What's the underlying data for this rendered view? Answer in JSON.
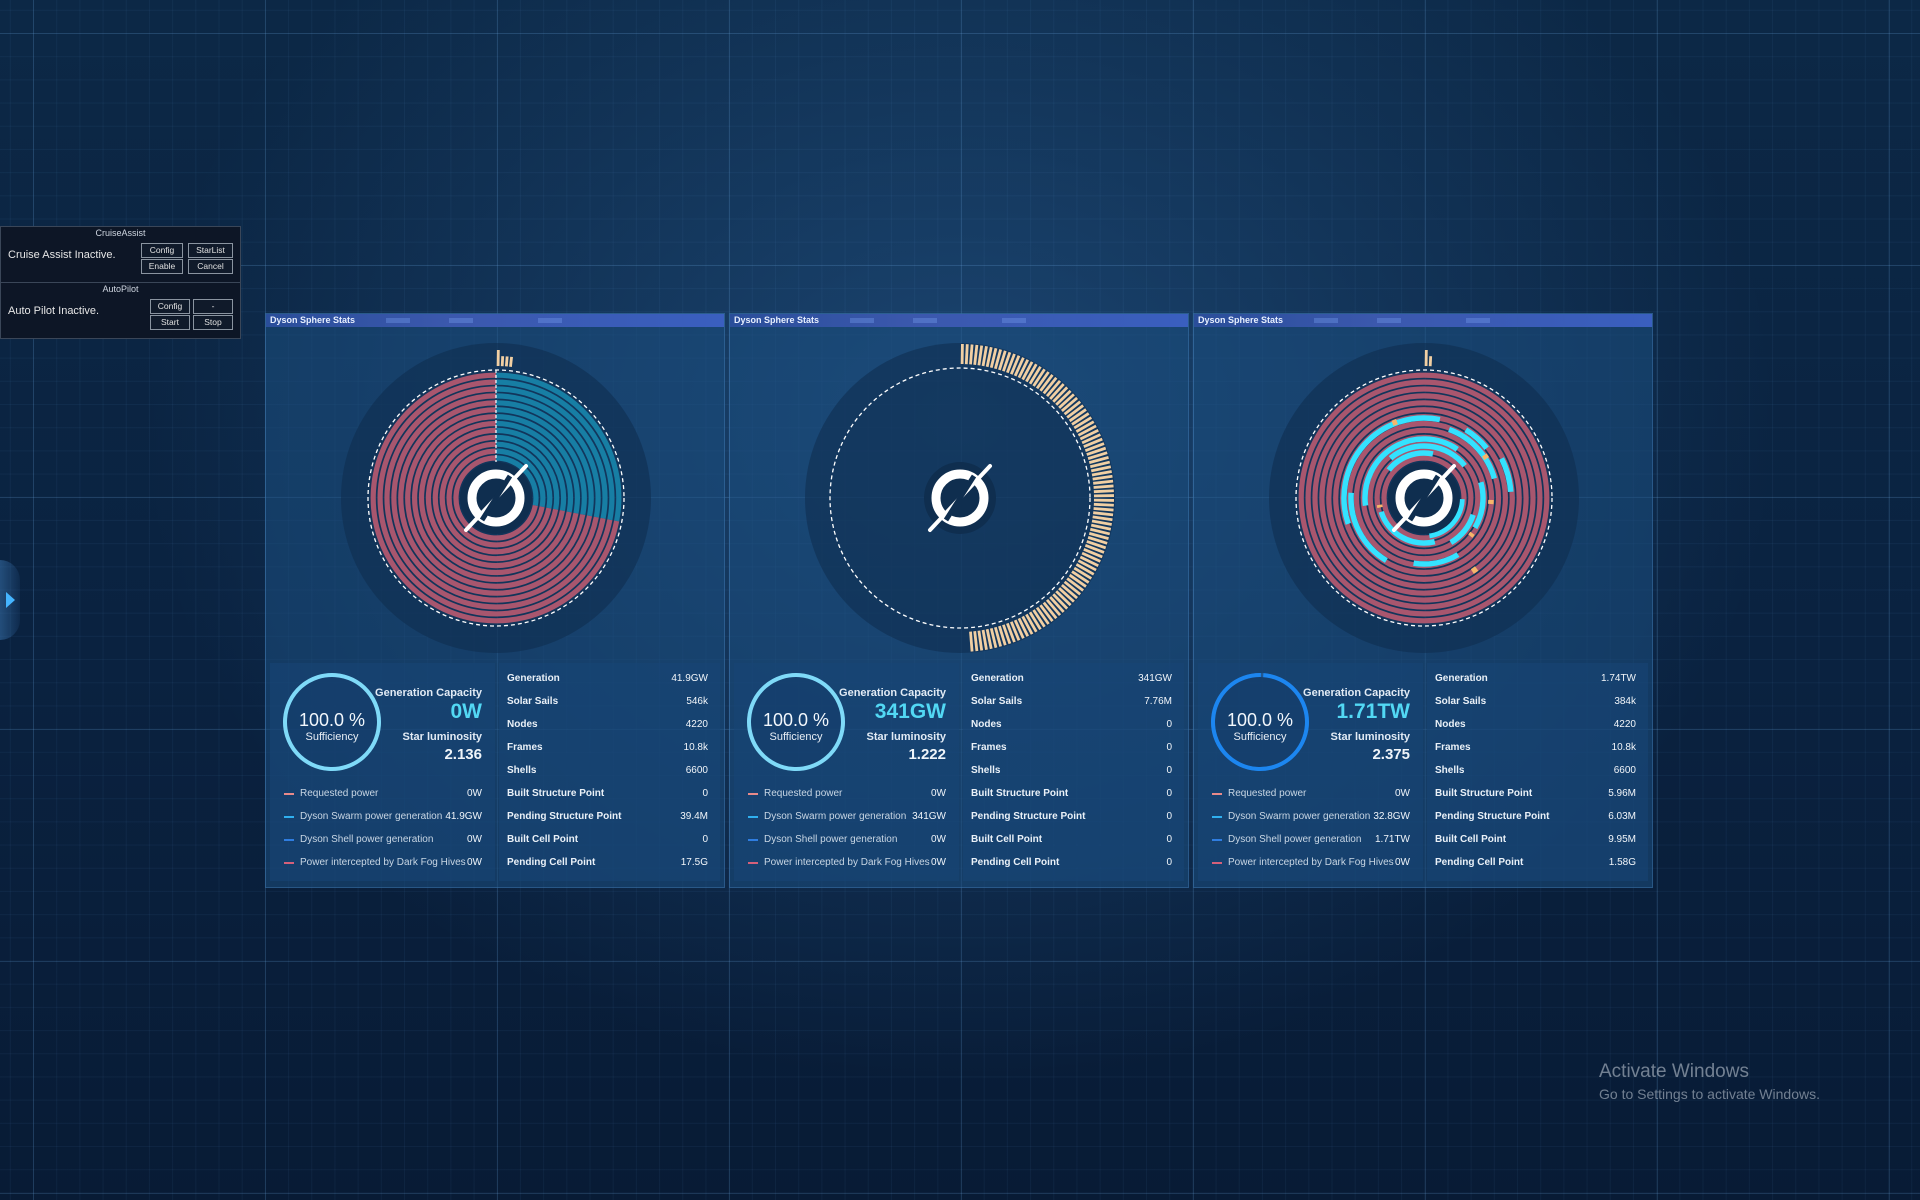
{
  "cruise_assist": {
    "title": "CruiseAssist",
    "status": "Cruise Assist Inactive.",
    "buttons": {
      "config": "Config",
      "starlist": "StarList",
      "enable": "Enable",
      "cancel": "Cancel"
    }
  },
  "auto_pilot": {
    "title": "AutoPilot",
    "status": "Auto Pilot Inactive.",
    "buttons": {
      "config": "Config",
      "dash": "-",
      "start": "Start",
      "stop": "Stop"
    }
  },
  "colors": {
    "shell": "#a8566e",
    "swarm": "#37b6e6",
    "sail_bars": "#f1cfa3",
    "bright_swarm": "#34e2ff",
    "requested": "#e88a8a",
    "swarm_gen": "#2fb0f0",
    "shell_gen": "#2f7de0",
    "dark_fog": "#d4607a"
  },
  "panels": [
    {
      "title": "Dyson Sphere Stats",
      "chart": {
        "type": "shells",
        "swarm_fraction": 0.28,
        "sails_fraction": 0.02
      },
      "sufficiency": "100.0 %",
      "sufficiency_label": "Sufficiency",
      "sufficiency_ratio": 1.0,
      "gen_capacity_label": "Generation Capacity",
      "gen_capacity": "0W",
      "star_lum_label": "Star luminosity",
      "star_lum": "2.136",
      "legend": [
        {
          "label": "Requested power",
          "value": "0W"
        },
        {
          "label": "Dyson Swarm power generation",
          "value": "41.9GW"
        },
        {
          "label": "Dyson Shell power generation",
          "value": "0W"
        },
        {
          "label": "Power intercepted by Dark Fog Hives",
          "value": "0W"
        }
      ],
      "stats": [
        {
          "label": "Generation",
          "value": "41.9GW"
        },
        {
          "label": "Solar Sails",
          "value": "546k"
        },
        {
          "label": "Nodes",
          "value": "4220"
        },
        {
          "label": "Frames",
          "value": "10.8k"
        },
        {
          "label": "Shells",
          "value": "6600"
        },
        {
          "label": "Built Structure Point",
          "value": "0"
        },
        {
          "label": "Pending Structure Point",
          "value": "39.4M"
        },
        {
          "label": "Built Cell Point",
          "value": "0"
        },
        {
          "label": "Pending Cell Point",
          "value": "17.5G"
        }
      ]
    },
    {
      "title": "Dyson Sphere Stats",
      "chart": {
        "type": "sails",
        "sails_fraction": 0.49
      },
      "sufficiency": "100.0 %",
      "sufficiency_label": "Sufficiency",
      "sufficiency_ratio": 1.0,
      "gen_capacity_label": "Generation Capacity",
      "gen_capacity": "341GW",
      "star_lum_label": "Star luminosity",
      "star_lum": "1.222",
      "legend": [
        {
          "label": "Requested power",
          "value": "0W"
        },
        {
          "label": "Dyson Swarm power generation",
          "value": "341GW"
        },
        {
          "label": "Dyson Shell power generation",
          "value": "0W"
        },
        {
          "label": "Power intercepted by Dark Fog Hives",
          "value": "0W"
        }
      ],
      "stats": [
        {
          "label": "Generation",
          "value": "341GW"
        },
        {
          "label": "Solar Sails",
          "value": "7.76M"
        },
        {
          "label": "Nodes",
          "value": "0"
        },
        {
          "label": "Frames",
          "value": "0"
        },
        {
          "label": "Shells",
          "value": "0"
        },
        {
          "label": "Built Structure Point",
          "value": "0"
        },
        {
          "label": "Pending Structure Point",
          "value": "0"
        },
        {
          "label": "Built Cell Point",
          "value": "0"
        },
        {
          "label": "Pending Cell Point",
          "value": "0"
        }
      ]
    },
    {
      "title": "Dyson Sphere Stats",
      "chart": {
        "type": "mixed",
        "sails_fraction": 0.01
      },
      "sufficiency": "100.0 %",
      "sufficiency_label": "Sufficiency",
      "sufficiency_ratio": 0.99,
      "gen_capacity_label": "Generation Capacity",
      "gen_capacity": "1.71TW",
      "star_lum_label": "Star luminosity",
      "star_lum": "2.375",
      "legend": [
        {
          "label": "Requested power",
          "value": "0W"
        },
        {
          "label": "Dyson Swarm power generation",
          "value": "32.8GW"
        },
        {
          "label": "Dyson Shell power generation",
          "value": "1.71TW"
        },
        {
          "label": "Power intercepted by Dark Fog Hives",
          "value": "0W"
        }
      ],
      "stats": [
        {
          "label": "Generation",
          "value": "1.74TW"
        },
        {
          "label": "Solar Sails",
          "value": "384k"
        },
        {
          "label": "Nodes",
          "value": "4220"
        },
        {
          "label": "Frames",
          "value": "10.8k"
        },
        {
          "label": "Shells",
          "value": "6600"
        },
        {
          "label": "Built Structure Point",
          "value": "5.96M"
        },
        {
          "label": "Pending Structure Point",
          "value": "6.03M"
        },
        {
          "label": "Built Cell Point",
          "value": "9.95M"
        },
        {
          "label": "Pending Cell Point",
          "value": "1.58G"
        }
      ]
    }
  ],
  "watermark": {
    "line1": "Activate Windows",
    "line2": "Go to Settings to activate Windows."
  }
}
